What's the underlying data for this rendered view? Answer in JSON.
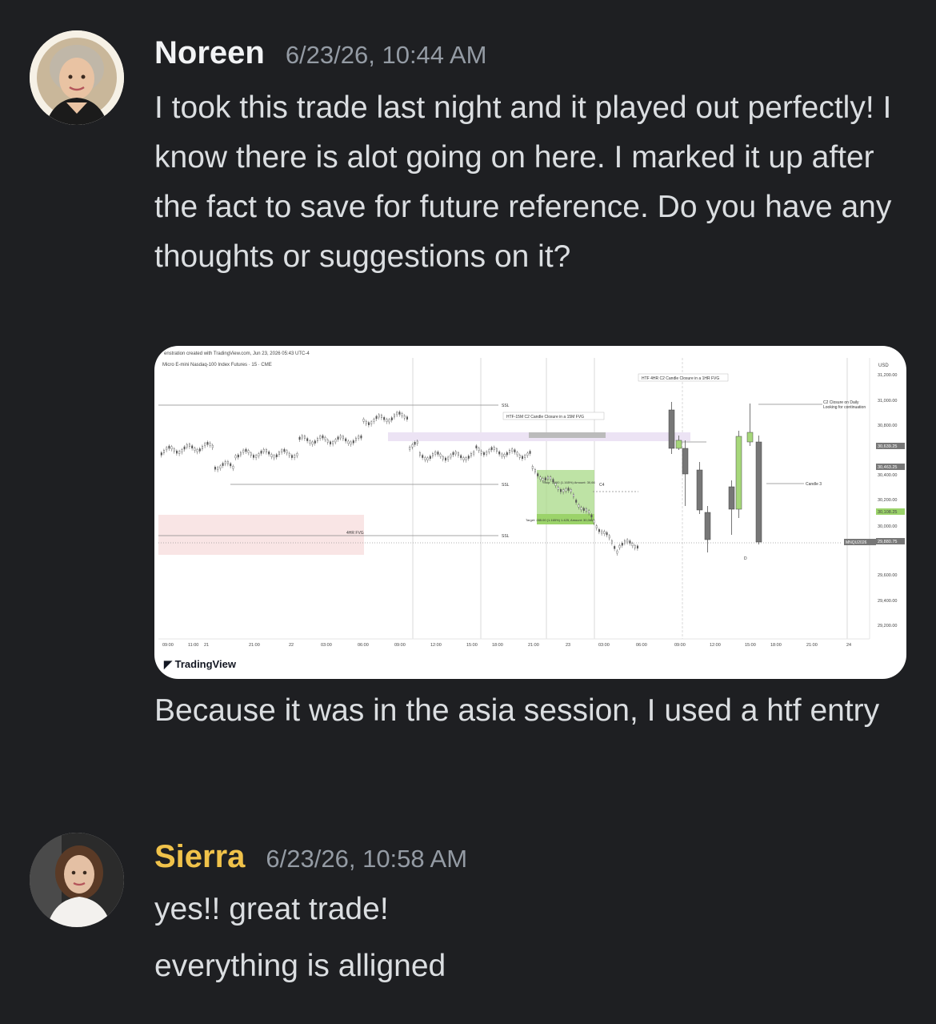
{
  "messages": [
    {
      "author": "Noreen",
      "timestamp": "6/23/26, 10:44 AM",
      "text": "I took this trade last night and it played out perfectly! I know there is alot going on here. I marked it up after the fact to save for future reference. Do you have any thoughts or suggestions on it?",
      "followup": "Because it was in the asia session, I used a htf entry"
    },
    {
      "author": "Sierra",
      "timestamp": "6/23/26, 10:58 AM",
      "lines": [
        "yes!! great trade!",
        "everything is alligned"
      ]
    }
  ],
  "chart": {
    "header": "enstration created with TradingView.com, Jun 23, 2026 05:43 UTC-4",
    "symbol": "Micro E-mini Nasdaq-100 Index Futures · 15 · CME",
    "currency": "USD",
    "price_labels": [
      "31,200.00",
      "31,000.00",
      "30,800.00",
      "30,639.25",
      "30,463.25",
      "30,400.00",
      "30,200.00",
      "30,108.25",
      "30,000.00",
      "29,880.75",
      "29,600.00",
      "29,400.00",
      "29,200.00"
    ],
    "symbol_tag": "MNQU2026",
    "current_price": "29,880.75",
    "current_time": "01:20",
    "time_labels": [
      "09:00",
      "11:00",
      "21",
      "21:00",
      "22",
      "03:00",
      "06:00",
      "09:00",
      "12:00",
      "15:00",
      "18:00",
      "21:00",
      "23",
      "03:00",
      "06:00",
      "09:00",
      "12:00",
      "15:00",
      "18:00",
      "21:00",
      "24"
    ],
    "annotations": {
      "htf_4hr": "HTF 4HR C2 Candle Closure in a 1HR FVG",
      "htf_15m": "HTF-15M C2 Candle Closure  in a 15M  FVG",
      "c2_daily_1": "C2 Closure on Daily",
      "c2_daily_2": "Looking for continuation",
      "candle3": "Candle 3",
      "hr_fvg": "4HR FVG",
      "ssl": "SSL",
      "c4": "C4",
      "d": "D",
      "target": "Target: 285.00 (1.165%) 1.425, Amount: 30,066",
      "stop": "Stop: 76.00 (1.165%) Amount: 30,66"
    },
    "branding": "TradingView"
  },
  "colors": {
    "background": "#1e1f22",
    "sierra_name": "#f0c24a",
    "text": "#dbdee1",
    "muted": "#949ba4"
  }
}
